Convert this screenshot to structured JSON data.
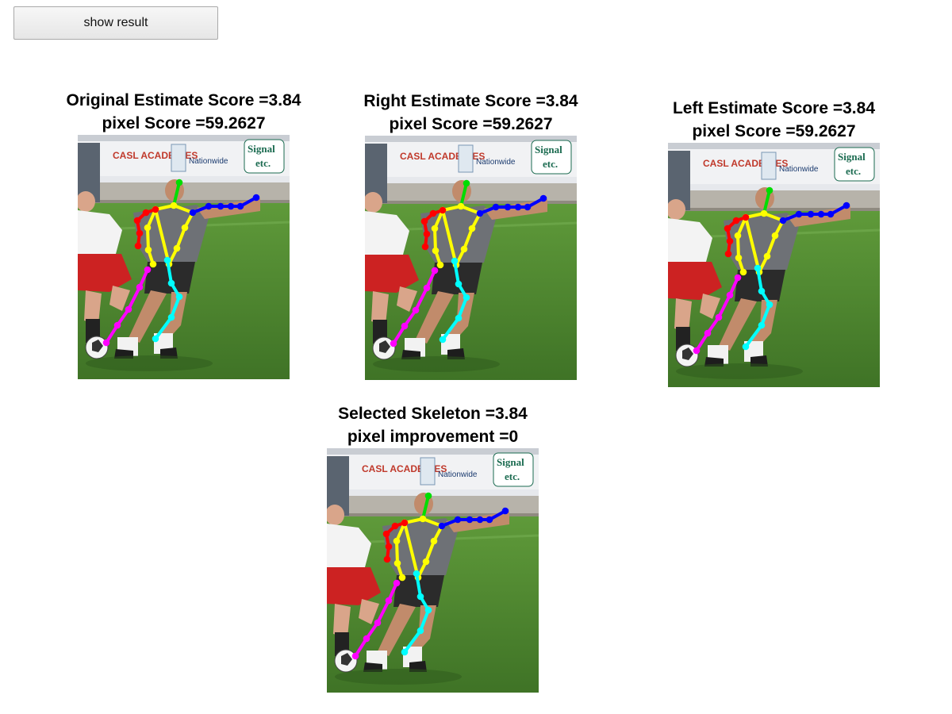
{
  "toolbar": {
    "show_result_label": "show result"
  },
  "panels": [
    {
      "title": "Original Estimate Score =3.84",
      "subtitle": "pixel Score =59.2627"
    },
    {
      "title": "Right Estimate Score =3.84",
      "subtitle": "pixel Score =59.2627"
    },
    {
      "title": "Left Estimate Score =3.84",
      "subtitle": "pixel Score =59.2627"
    },
    {
      "title": "Selected Skeleton =3.84",
      "subtitle": "pixel improvement =0"
    }
  ],
  "banner_text": {
    "left": "CASL ACADEMIES",
    "middle": "Nationwide",
    "right_top": "Signal",
    "right_bottom": "etc."
  },
  "skeleton_colors": {
    "head": "#00dd00",
    "torso": "#ffff00",
    "right_arm": "#0000ff",
    "left_arm": "#ff0000",
    "left_leg": "#ff00ff",
    "right_leg": "#00ffff"
  }
}
